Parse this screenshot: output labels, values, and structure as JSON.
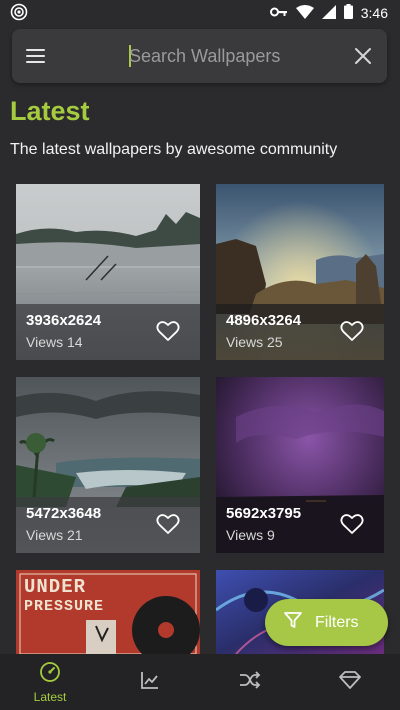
{
  "status_bar": {
    "time": "3:46"
  },
  "search": {
    "placeholder": "Search Wallpapers"
  },
  "header": {
    "title": "Latest",
    "subtitle": "The latest wallpapers by awesome community"
  },
  "wallpapers": [
    {
      "resolution": "3936x2624",
      "views": "Views 14",
      "scene": "misty-lake"
    },
    {
      "resolution": "4896x3264",
      "views": "Views 25",
      "scene": "sunlit-cliffs"
    },
    {
      "resolution": "5472x3648",
      "views": "Views 21",
      "scene": "river-valley"
    },
    {
      "resolution": "5692x3795",
      "views": "Views 9",
      "scene": "purple-storm"
    },
    {
      "resolution": "",
      "views": "",
      "scene": "under-pressure-poster"
    },
    {
      "resolution": "",
      "views": "",
      "scene": "neon-artwork"
    }
  ],
  "wallpaper_poster_text": {
    "line1": "UNDER",
    "line2": "PRESSURE"
  },
  "fab": {
    "label": "Filters"
  },
  "bottom_nav": {
    "items": [
      {
        "label": "Latest",
        "icon": "gauge-icon",
        "active": true
      },
      {
        "label": "",
        "icon": "trending-chart-icon",
        "active": false
      },
      {
        "label": "",
        "icon": "shuffle-icon",
        "active": false
      },
      {
        "label": "",
        "icon": "diamond-icon",
        "active": false
      }
    ]
  },
  "colors": {
    "accent": "#a5cc3e",
    "background": "#2b2b2d",
    "surface": "#3a3a3c",
    "nav": "#232325"
  }
}
